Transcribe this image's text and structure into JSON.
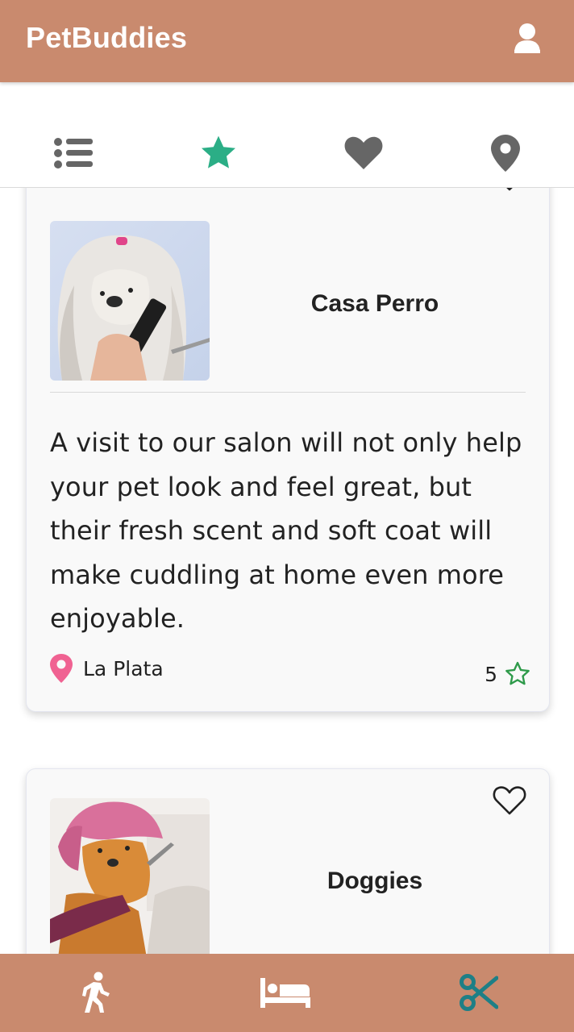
{
  "app": {
    "title": "PetBuddies",
    "accent_color": "#c98a6e"
  },
  "header": {
    "profile_icon": "user-icon"
  },
  "tabs": [
    {
      "icon": "list-icon",
      "active": false
    },
    {
      "icon": "star-icon",
      "active": true,
      "color": "#2bae86"
    },
    {
      "icon": "heart-icon",
      "active": false
    },
    {
      "icon": "location-pin-icon",
      "active": false
    }
  ],
  "cards": [
    {
      "name": "Casa Perro",
      "description": "A visit to our salon will not only help your pet look and feel great, but their fresh scent and soft coat will make cuddling at home even more enjoyable.",
      "location": "La Plata",
      "rating": "5",
      "image": "dog-grooming-photo"
    },
    {
      "name": "Doggies",
      "image": "dog-towel-photo"
    }
  ],
  "bottom_nav": [
    {
      "icon": "walking-icon",
      "active": false
    },
    {
      "icon": "bed-icon",
      "active": false
    },
    {
      "icon": "scissors-icon",
      "active": true,
      "color": "#1e7f86"
    }
  ]
}
